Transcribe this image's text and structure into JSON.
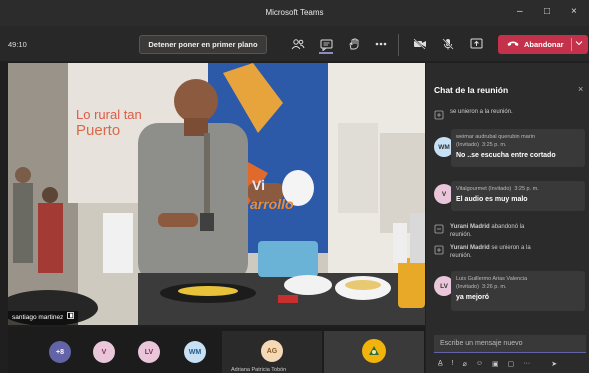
{
  "window": {
    "title": "Microsoft Teams",
    "minimize_glyph": "–",
    "maximize_glyph": "□",
    "close_glyph": "×"
  },
  "toolbar": {
    "timer": "49:10",
    "stop_spotlight_label": "Detener poner en primer plano",
    "leave_label": "Abandonar",
    "icons": [
      "participants-icon",
      "chat-icon",
      "raise-hand-icon",
      "more-icon",
      "camera-off-icon",
      "mic-off-icon",
      "share-icon"
    ]
  },
  "video": {
    "speaker_name": "santiago martinez",
    "banner_line1": "Lo rural tan",
    "banner_line2": "Puerto",
    "banner_vi": "Vi",
    "banner_arrollo": "arrollo"
  },
  "participants": [
    {
      "initials": "+8",
      "color": "#6264a7"
    },
    {
      "initials": "V",
      "color": "#e9c6da"
    },
    {
      "initials": "LV",
      "color": "#e9c6da"
    },
    {
      "initials": "WM",
      "color": "#c7e0f4"
    },
    {
      "initials": "AG",
      "color": "#f5d9b6",
      "name": "Adriana Patricia Tobón"
    }
  ],
  "chat": {
    "title": "Chat de la reunión",
    "close_glyph": "×",
    "system_top": "se unieron a la reunión.",
    "messages": [
      {
        "initials": "WM",
        "avatar_color": "#c7e0f4",
        "sender": "weimar audrubal querubin marin",
        "tag": "(Invitado)",
        "time": "3:25 p. m.",
        "text": "No ..se escucha entre cortado"
      },
      {
        "initials": "V",
        "avatar_color": "#e9c6da",
        "sender": "Vitalgourmet",
        "tag": "(Invitado)",
        "time": "3:25 p. m.",
        "text": "El audio es muy malo"
      },
      {
        "initials": "LV",
        "avatar_color": "#e9c6da",
        "sender": "Luis Guillermo Arias Valencia",
        "tag": "(Invitado)",
        "time": "3:26 p. m.",
        "text": "ya mejoró"
      }
    ],
    "system_left": {
      "name": "Yurani Madrid",
      "rest": "abandonó la",
      "rest2": "reunión."
    },
    "system_joined": {
      "name": "Yurani Madrid",
      "rest": "se unieron a la",
      "rest2": "reunión."
    },
    "compose_placeholder": "Escribe un mensaje nuevo"
  },
  "colors": {
    "accent": "#6264a7",
    "leave": "#c4314b",
    "panel": "#2c2b2b"
  }
}
